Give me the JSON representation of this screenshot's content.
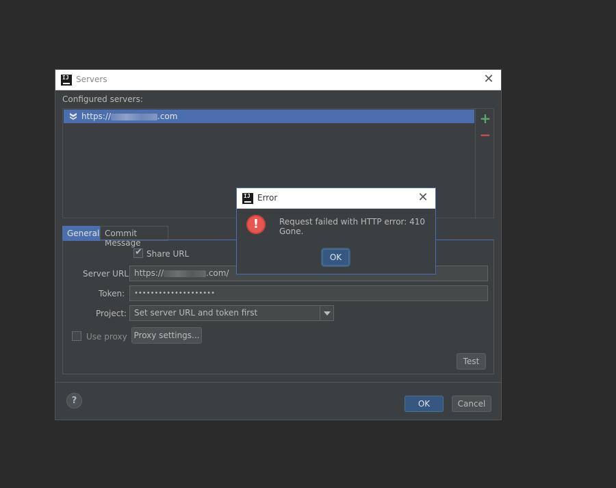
{
  "servers_dialog": {
    "title": "Servers",
    "configured_label": "Configured servers:",
    "server_item": {
      "prefix": "https://",
      "suffix": ".com"
    },
    "tabs": [
      {
        "label": "General"
      },
      {
        "label": "Commit Message"
      }
    ],
    "share_url_label": "Share URL",
    "share_url_checked": true,
    "server_url_label": "Server URL:",
    "server_url_prefix": "https://",
    "server_url_suffix": ".com/",
    "token_label": "Token:",
    "token_value": "••••••••••••••••••••",
    "project_label": "Project:",
    "project_value": "Set server URL and token first",
    "use_proxy_label": "Use proxy",
    "use_proxy_checked": false,
    "proxy_settings_label": "Proxy settings...",
    "test_label": "Test",
    "ok_label": "OK",
    "cancel_label": "Cancel",
    "help_label": "?",
    "add_symbol": "+",
    "remove_symbol": "−"
  },
  "error_dialog": {
    "title": "Error",
    "message": "Request failed with HTTP error: 410 Gone.",
    "ok_label": "OK",
    "icon_symbol": "!"
  },
  "colors": {
    "background": "#2b2b2b",
    "panel": "#3c3f41",
    "selection": "#4b6eaf",
    "add": "#59a869",
    "remove": "#c75450",
    "error_icon": "#e8574f"
  },
  "icons": {
    "app": "intellij-icon",
    "close": "close-icon",
    "server": "server-icon",
    "add": "plus-icon",
    "remove": "minus-icon",
    "help": "help-icon",
    "error": "error-icon",
    "dropdown": "chevron-down-icon"
  }
}
